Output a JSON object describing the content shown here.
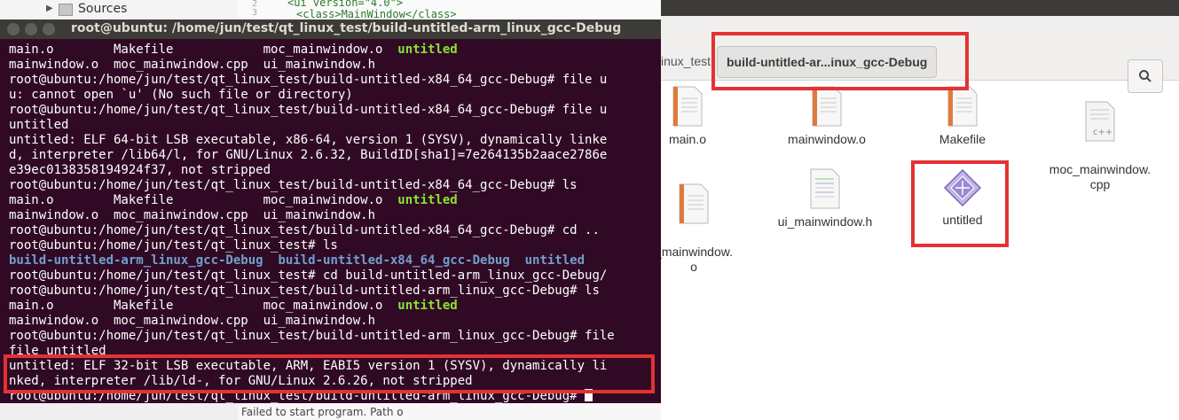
{
  "ide": {
    "tree_label": "Sources",
    "line_numbers": [
      "2",
      "3"
    ],
    "code_lines": [
      "<ui version=\"4.0\">",
      "<class>MainWindow</class>"
    ],
    "bottom_text": "Failed to start program. Path o"
  },
  "terminal": {
    "title": "root@ubuntu: /home/jun/test/qt_linux_test/build-untitled-arm_linux_gcc-Debug",
    "lines": [
      [
        {
          "t": "main.o        Makefile            moc_mainwindow.o  "
        },
        {
          "t": "untitled",
          "c": "g"
        }
      ],
      [
        {
          "t": "mainwindow.o  moc_mainwindow.cpp  ui_mainwindow.h"
        }
      ],
      [
        {
          "t": "root@ubuntu:/home/jun/test/qt_linux_test/build-untitled-x84_64_gcc-Debug# file u"
        }
      ],
      [
        {
          "t": "u: cannot open `u' (No such file or directory)"
        }
      ],
      [
        {
          "t": "root@ubuntu:/home/jun/test/qt_linux_test/build-untitled-x84_64_gcc-Debug# file u"
        }
      ],
      [
        {
          "t": "untitled"
        }
      ],
      [
        {
          "t": "untitled: ELF 64-bit LSB executable, x86-64, version 1 (SYSV), dynamically linke"
        }
      ],
      [
        {
          "t": "d, interpreter /lib64/l, for GNU/Linux 2.6.32, BuildID[sha1]=7e264135b2aace2786e"
        }
      ],
      [
        {
          "t": "e39ec0138358194924f37, not stripped"
        }
      ],
      [
        {
          "t": "root@ubuntu:/home/jun/test/qt_linux_test/build-untitled-x84_64_gcc-Debug# ls"
        }
      ],
      [
        {
          "t": "main.o        Makefile            moc_mainwindow.o  "
        },
        {
          "t": "untitled",
          "c": "g"
        }
      ],
      [
        {
          "t": "mainwindow.o  moc_mainwindow.cpp  ui_mainwindow.h"
        }
      ],
      [
        {
          "t": "root@ubuntu:/home/jun/test/qt_linux_test/build-untitled-x84_64_gcc-Debug# cd .."
        }
      ],
      [
        {
          "t": "root@ubuntu:/home/jun/test/qt_linux_test# ls"
        }
      ],
      [
        {
          "t": "build-untitled-arm_linux_gcc-Debug",
          "c": "b"
        },
        {
          "t": "  "
        },
        {
          "t": "build-untitled-x84_64_gcc-Debug",
          "c": "b"
        },
        {
          "t": "  "
        },
        {
          "t": "untitled",
          "c": "b"
        }
      ],
      [
        {
          "t": "root@ubuntu:/home/jun/test/qt_linux_test# cd build-untitled-arm_linux_gcc-Debug/"
        }
      ],
      [
        {
          "t": "root@ubuntu:/home/jun/test/qt_linux_test/build-untitled-arm_linux_gcc-Debug# ls"
        }
      ],
      [
        {
          "t": "main.o        Makefile            moc_mainwindow.o  "
        },
        {
          "t": "untitled",
          "c": "g"
        }
      ],
      [
        {
          "t": "mainwindow.o  moc_mainwindow.cpp  ui_mainwindow.h"
        }
      ],
      [
        {
          "t": "root@ubuntu:/home/jun/test/qt_linux_test/build-untitled-arm_linux_gcc-Debug# file"
        }
      ],
      [
        {
          "t": "file untitled"
        }
      ],
      [
        {
          "t": "untitled: ELF 32-bit LSB executable, ARM, EABI5 version 1 (SYSV), dynamically li"
        }
      ],
      [
        {
          "t": "nked, interpreter /lib/ld-, for GNU/Linux 2.6.26, not stripped"
        }
      ],
      [
        {
          "t": "root@ubuntu:/home/jun/test/qt_linux_test/build-untitled-arm_linux_gcc-Debug# "
        }
      ]
    ]
  },
  "file_manager": {
    "breadcrumb_prev": "inux_test",
    "breadcrumb_current": "build-untitled-ar...inux_gcc-Debug",
    "files": [
      {
        "name": "main.o",
        "icon": "text-file-icon"
      },
      {
        "name": "mainwindow.o",
        "icon": "text-file-icon"
      },
      {
        "name": "Makefile",
        "icon": "text-file-icon"
      },
      {
        "name": "moc_mainwindow.\ncpp",
        "icon": "cpp-file-icon"
      },
      {
        "name": "_mainwindow.\no",
        "icon": "text-file-icon"
      },
      {
        "name": "ui_mainwindow.h",
        "icon": "header-file-icon"
      },
      {
        "name": "untitled",
        "icon": "executable-icon"
      }
    ]
  },
  "colors": {
    "terminal_bg": "#300a24",
    "highlight": "#e33233",
    "exec_green": "#8ae234",
    "dir_blue": "#729fcf"
  }
}
